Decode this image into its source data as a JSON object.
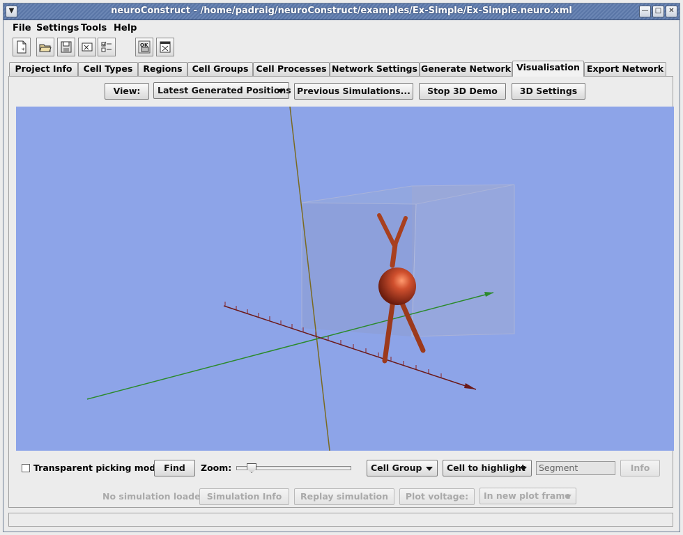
{
  "window": {
    "title": "neuroConstruct - /home/padraig/neuroConstruct/examples/Ex-Simple/Ex-Simple.neuro.xml",
    "controls": [
      "minimize-icon",
      "maximize-icon",
      "close-icon"
    ]
  },
  "menu": {
    "items": [
      "File",
      "Settings",
      "Tools",
      "Help"
    ]
  },
  "toolbar": {
    "buttons": [
      "new-project-icon",
      "open-project-icon",
      "save-project-icon",
      "close-project-icon",
      "preferences-icon",
      "validate-icon",
      "exit-icon"
    ]
  },
  "tabs": {
    "items": [
      "Project Info",
      "Cell Types",
      "Regions",
      "Cell Groups",
      "Cell Processes",
      "Network Settings",
      "Generate Network",
      "Visualisation",
      "Export Network"
    ],
    "active": "Visualisation"
  },
  "vis_toolbar": {
    "view_button": "View:",
    "view_select": "Latest Generated Positions",
    "previous_sims": "Previous Simulations...",
    "stop_demo": "Stop 3D Demo",
    "settings_3d": "3D Settings"
  },
  "viewport": {
    "background": "#8da4e8",
    "cell_color": "#b5412a",
    "axis_colors": {
      "x": "#6b1a1a",
      "y": "#2b7a2b",
      "z": "#7a6a20"
    }
  },
  "bottom": {
    "transparent_picking": "Transparent picking mode",
    "transparent_picking_checked": false,
    "find": "Find",
    "zoom_label": "Zoom:",
    "zoom_level": 0.1,
    "cell_group": "Cell Group",
    "cell_highlight": "Cell to highlight",
    "segment_field": "Segment",
    "info": "Info",
    "no_sim": "No simulation loaded",
    "sim_info": "Simulation Info",
    "replay": "Replay simulation",
    "plot_voltage": "Plot voltage:",
    "plot_target": "In new plot frame"
  }
}
